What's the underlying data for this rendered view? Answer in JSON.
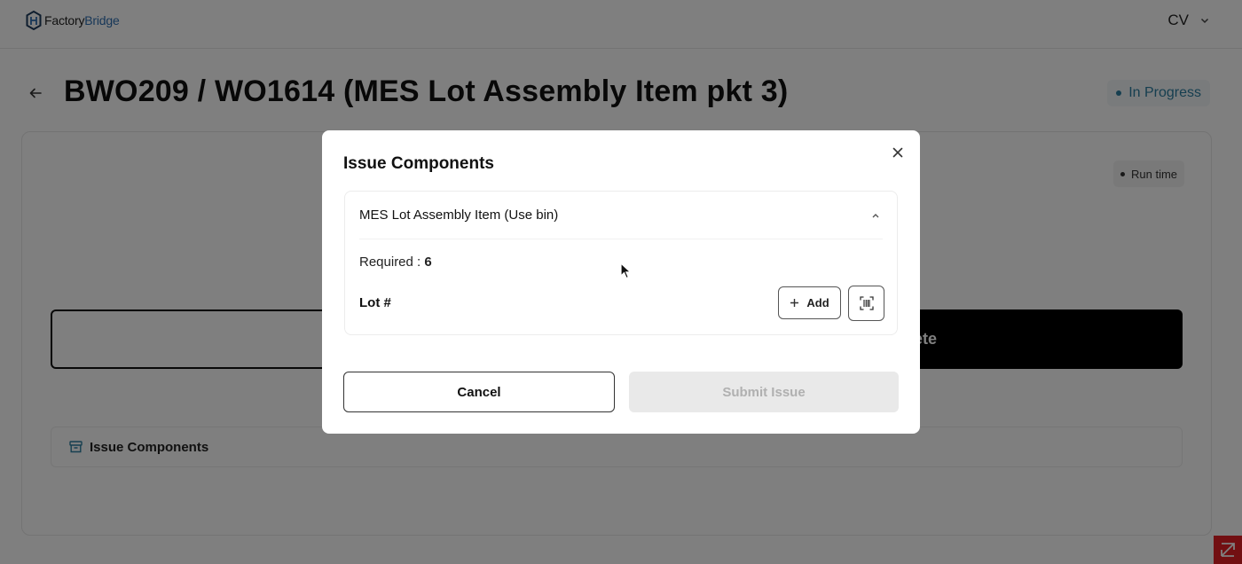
{
  "header": {
    "logo_prefix": "Factory",
    "logo_suffix": "Bridge",
    "user_initials": "CV",
    "colors": {
      "brand_accent": "#2f6fb0"
    }
  },
  "page": {
    "title": "BWO209 / WO1614 (MES Lot Assembly Item pkt 3)",
    "status": "In Progress",
    "status_color": "#2d7ea1"
  },
  "card": {
    "runtime_label": "Run time",
    "complete_label": "Complete",
    "issue_components_label": "Issue Components"
  },
  "modal": {
    "title": "Issue Components",
    "component": {
      "name": "MES Lot Assembly Item (Use bin)",
      "required_label": "Required :",
      "required_value": "6",
      "lot_label": "Lot #",
      "add_label": "Add"
    },
    "cancel_label": "Cancel",
    "submit_label": "Submit Issue"
  }
}
